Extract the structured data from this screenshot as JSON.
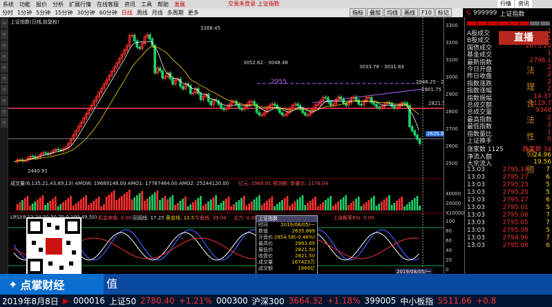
{
  "menu": [
    "系统",
    "功能",
    "报价",
    "分析",
    "扩展行情",
    "在线客服",
    "资讯",
    "工具",
    "帮助",
    "发展"
  ],
  "top_center": "交易未登录  上证指数",
  "window_controls": [
    "行情",
    "资讯"
  ],
  "toolbar": [
    "分时",
    "1分钟",
    "5分钟",
    "15分钟",
    "30分钟",
    "60分钟",
    "日线",
    "周线",
    "月线",
    "多周期",
    "更多"
  ],
  "toolbar_active": "日线",
  "right_tabs": [
    "指标",
    "叠加",
    "均线",
    "画线",
    "F10",
    "标记"
  ],
  "chart_title": "上证指数(日线,前复权)",
  "price_annotations": {
    "high": "3288.45",
    "mid1": "3052.62 - 3048.48",
    "mid2": "3033.78 - 3031.83",
    "right1": "2946.25 - 29",
    "right2": "2901.75",
    "right3": "2821.50",
    "low": "2440.91",
    "line": "2955",
    "price_tag": "2635.9"
  },
  "y_ticks": [
    "3300",
    "3200",
    "3100",
    "3000",
    "2900",
    "2800",
    "2700",
    "2600",
    "2500"
  ],
  "volume_label": "成交量(6,135,21,43,89,13)  AMOW: 19689148.00  AMO1: 17787464.00  AMO2: 25244120.00",
  "volume_label2": "亿元: 1969.91  预测额: 新量比: 1176.04",
  "volume_ticks": [
    "40000",
    "20000",
    "X10000"
  ],
  "lrs_label": "LRSI(8,12,24,50,50,70,0,100,49,50)",
  "lrs_tags": [
    "机会来临: 0.00",
    "回调线: 17.25",
    "黄金线: 12.5",
    "牛股线: 39.04",
    "主力: 0.00",
    "上涨概率RSI: 0.00"
  ],
  "lrs_ticks": [
    "100",
    "80",
    "60",
    "40",
    "20",
    "0"
  ],
  "date_label": "2019/08/05/一",
  "infobox": {
    "title": "上证指数",
    "rows": [
      [
        "时间",
        "2019/08/05/一"
      ],
      [
        "数值",
        "2635.869"
      ],
      [
        "开盘价",
        "2854.58(-0.46%)"
      ],
      [
        "最高价",
        "2863.69"
      ],
      [
        "最低价",
        "2821.50"
      ],
      [
        "收盘价",
        "2821.50"
      ],
      [
        "成交量",
        "167423万"
      ],
      [
        "成交额",
        "1969亿"
      ]
    ]
  },
  "quote_header": {
    "code": "999999",
    "name": "上证指数"
  },
  "live_badge": "直播",
  "quote_rows": [
    [
      "A股成交",
      "1"
    ],
    [
      "B股成交",
      "1"
    ],
    [
      "国债成交",
      "2675.20"
    ],
    [
      "基金成交",
      "1"
    ],
    [
      "最新指数",
      "2796.1"
    ],
    [
      "今日开盘",
      "2"
    ],
    [
      "昨日收盘",
      "2"
    ],
    [
      "指数涨跌",
      "2"
    ],
    [
      "指数涨幅",
      "2"
    ],
    [
      "指数振幅",
      "14.37"
    ],
    [
      "总成交额",
      "1119.7"
    ],
    [
      "总成交量",
      "9348"
    ],
    [
      "最高指数",
      "2"
    ],
    [
      "最低指数",
      "2"
    ],
    [
      "指数量比",
      "1"
    ],
    [
      "上证换手",
      "0"
    ]
  ],
  "breadth": {
    "up_label": "涨家数",
    "up": "1125",
    "down_label": "跌家数",
    "down": "34"
  },
  "flows": [
    [
      "净流入额",
      "24.96"
    ],
    [
      "大宗流入",
      "19.56"
    ]
  ],
  "ticks": [
    [
      "13:03",
      "2795.14",
      "7"
    ],
    [
      "13:03",
      "2795.27",
      "6"
    ],
    [
      "13:03",
      "2795.23",
      "5"
    ],
    [
      "13:03",
      "2795.20",
      "5"
    ],
    [
      "13:03",
      "2795.27",
      "6"
    ],
    [
      "13:03",
      "2795.01",
      "5"
    ],
    [
      "13:03",
      "2795.06",
      "7"
    ],
    [
      "13:03",
      "2795.05",
      "7"
    ],
    [
      "13:03",
      "2795.08",
      "5"
    ],
    [
      "13:03",
      "2794.96",
      "7"
    ],
    [
      "13:03",
      "2795.08",
      "6"
    ]
  ],
  "overlay_text": "法\n理\n合\n法\n性\n验\n资",
  "brand": "点掌财经",
  "brand2": "值",
  "date": "2019年8月8日",
  "ticker": [
    {
      "code": "000016",
      "name": "上证50",
      "price": "2780.40",
      "chg": "+1.21%"
    },
    {
      "code": "000300",
      "name": "沪深300",
      "price": "3664.32",
      "chg": "+1.18%"
    },
    {
      "code": "399005",
      "name": "中小板指",
      "price": "5511.66",
      "chg": "+0.8"
    }
  ]
}
